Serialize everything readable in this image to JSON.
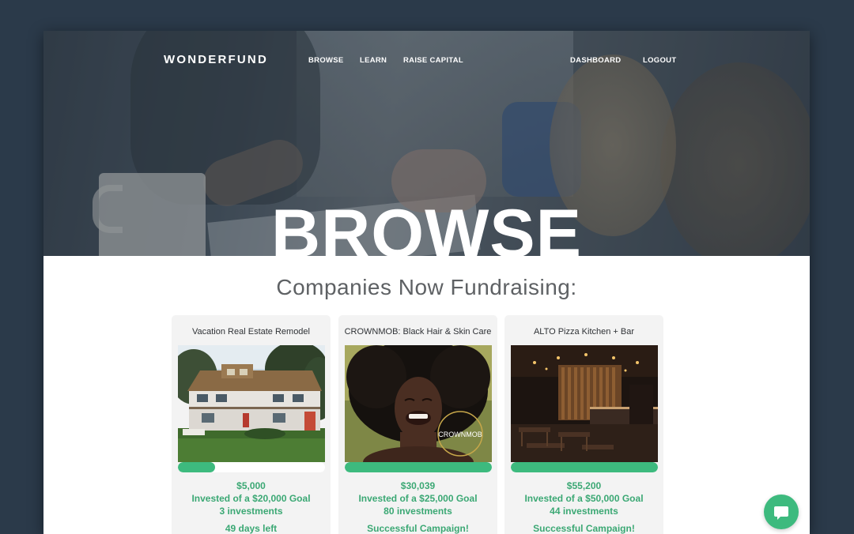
{
  "header": {
    "logo": "WONDERFUND",
    "nav": {
      "browse": "BROWSE",
      "learn": "LEARN",
      "raise_capital": "RAISE CAPITAL",
      "dashboard": "DASHBOARD",
      "logout": "LOGOUT"
    },
    "hero_title": "BROWSE"
  },
  "main": {
    "heading": "Companies Now Fundraising:",
    "cards": [
      {
        "title": "Vacation Real Estate Remodel",
        "amount": "$5,000",
        "goal": "Invested of a $20,000 Goal",
        "investments": "3 investments",
        "status": "49 days left",
        "progress_pct": 25
      },
      {
        "title": "CROWNMOB: Black Hair & Skin Care",
        "amount": "$30,039",
        "goal": "Invested of a $25,000 Goal",
        "investments": "80 investments",
        "status": "Successful Campaign!",
        "progress_pct": 100,
        "image_badge": "CROWNMOB"
      },
      {
        "title": "ALTO Pizza Kitchen + Bar",
        "amount": "$55,200",
        "goal": "Invested of a $50,000 Goal",
        "investments": "44 investments",
        "status": "Successful Campaign!",
        "progress_pct": 100
      }
    ]
  },
  "chat": {
    "icon": "chat-bubble-icon"
  },
  "colors": {
    "accent": "#3dba7e",
    "background": "#2b3a4a"
  }
}
